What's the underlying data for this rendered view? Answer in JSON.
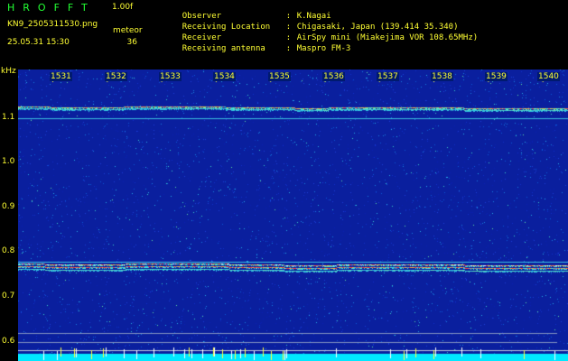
{
  "header": {
    "title": "HROFFT",
    "version": "1.00f",
    "filename": "KN9_2505311530.png",
    "datetime": "25.05.31 15:30",
    "meteor_label": "meteor",
    "meteor_count": "36"
  },
  "info": [
    {
      "label": "Observer",
      "value": "K.Nagai"
    },
    {
      "label": "Receiving Location",
      "value": "Chigasaki, Japan (139.414 35.340)"
    },
    {
      "label": "Receiver",
      "value": "AirSpy mini (Miakejima VOR 108.65MHz)"
    },
    {
      "label": "Receiving antenna",
      "value": "Maspro FM-3"
    }
  ],
  "axis": {
    "unit": "kHz",
    "y_ticks": [
      "1.1",
      "1.0",
      "0.9",
      "0.8",
      "0.7",
      "0.6"
    ],
    "x_ticks": [
      "1531",
      "1532",
      "1533",
      "1534",
      "1535",
      "1536",
      "1537",
      "1538",
      "1539",
      "1540"
    ]
  },
  "colors": {
    "background": "#000000",
    "spectrogram": "#0a1f9e",
    "text": "#ffff33",
    "title": "#22ff33"
  }
}
